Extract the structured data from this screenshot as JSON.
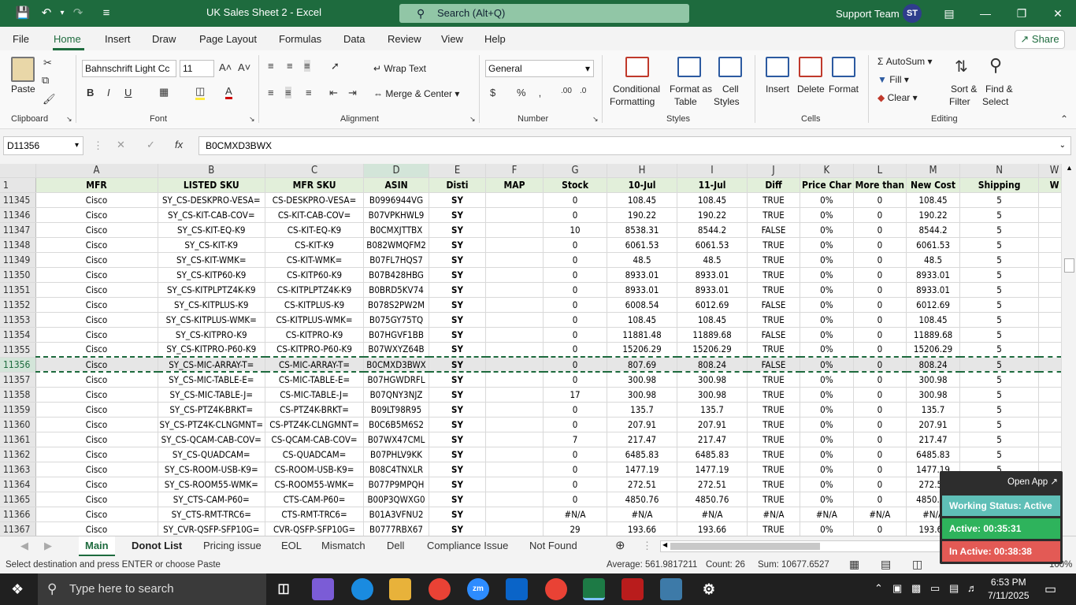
{
  "app": {
    "doc_title": "UK Sales Sheet 2  -  Excel",
    "search_placeholder": "Search (Alt+Q)",
    "account_name": "Support Team",
    "account_initials": "ST"
  },
  "ribbon_tabs": [
    "File",
    "Home",
    "Insert",
    "Draw",
    "Page Layout",
    "Formulas",
    "Data",
    "Review",
    "View",
    "Help"
  ],
  "share_label": "Share",
  "ribbon": {
    "clipboard": {
      "paste": "Paste",
      "group": "Clipboard"
    },
    "font": {
      "name": "Bahnschrift Light Cc",
      "size": "11",
      "group": "Font",
      "bold": "B",
      "italic": "I",
      "underline": "U"
    },
    "alignment": {
      "wrap": "Wrap Text",
      "merge": "Merge & Center",
      "group": "Alignment"
    },
    "number": {
      "format": "General",
      "group": "Number"
    },
    "styles": {
      "conditional": "Conditional",
      "conditional2": "Formatting",
      "format_table": "Format as",
      "format_table2": "Table",
      "cell_styles": "Cell",
      "cell_styles2": "Styles",
      "group": "Styles"
    },
    "cells": {
      "insert": "Insert",
      "delete": "Delete",
      "format": "Format",
      "group": "Cells"
    },
    "editing": {
      "autosum": "AutoSum",
      "fill": "Fill",
      "clear": "Clear",
      "sort": "Sort &",
      "sort2": "Filter",
      "find": "Find &",
      "find2": "Select",
      "group": "Editing"
    }
  },
  "formula_bar": {
    "name_box": "D11356",
    "fx": "fx",
    "content": "B0CMXD3BWX"
  },
  "grid": {
    "columns": [
      "A",
      "B",
      "C",
      "D",
      "E",
      "F",
      "G",
      "H",
      "I",
      "J",
      "K",
      "L",
      "M",
      "N",
      "W"
    ],
    "header_row_num": "1",
    "headers": [
      "MFR",
      "LISTED SKU",
      "MFR SKU",
      "ASIN",
      "Disti",
      "MAP",
      "Stock",
      "10-Jul",
      "11-Jul",
      "Diff",
      "Price Char",
      "More than",
      "New Cost",
      "Shipping",
      "W"
    ],
    "rows": [
      {
        "n": "11345",
        "c": [
          "Cisco",
          "SY_CS-DESKPRO-VESA=",
          "CS-DESKPRO-VESA=",
          "B0996944VG",
          "SY",
          "",
          "0",
          "108.45",
          "108.45",
          "TRUE",
          "0%",
          "0",
          "108.45",
          "5",
          ""
        ]
      },
      {
        "n": "11346",
        "c": [
          "Cisco",
          "SY_CS-KIT-CAB-COV=",
          "CS-KIT-CAB-COV=",
          "B07VPKHWL9",
          "SY",
          "",
          "0",
          "190.22",
          "190.22",
          "TRUE",
          "0%",
          "0",
          "190.22",
          "5",
          ""
        ]
      },
      {
        "n": "11347",
        "c": [
          "Cisco",
          "SY_CS-KIT-EQ-K9",
          "CS-KIT-EQ-K9",
          "B0CMXJTTBX",
          "SY",
          "",
          "10",
          "8538.31",
          "8544.2",
          "FALSE",
          "0%",
          "0",
          "8544.2",
          "5",
          ""
        ]
      },
      {
        "n": "11348",
        "c": [
          "Cisco",
          "SY_CS-KIT-K9",
          "CS-KIT-K9",
          "B082WMQFM2",
          "SY",
          "",
          "0",
          "6061.53",
          "6061.53",
          "TRUE",
          "0%",
          "0",
          "6061.53",
          "5",
          ""
        ]
      },
      {
        "n": "11349",
        "c": [
          "Cisco",
          "SY_CS-KIT-WMK=",
          "CS-KIT-WMK=",
          "B07FL7HQS7",
          "SY",
          "",
          "0",
          "48.5",
          "48.5",
          "TRUE",
          "0%",
          "0",
          "48.5",
          "5",
          ""
        ]
      },
      {
        "n": "11350",
        "c": [
          "Cisco",
          "SY_CS-KITP60-K9",
          "CS-KITP60-K9",
          "B07B428HBG",
          "SY",
          "",
          "0",
          "8933.01",
          "8933.01",
          "TRUE",
          "0%",
          "0",
          "8933.01",
          "5",
          ""
        ]
      },
      {
        "n": "11351",
        "c": [
          "Cisco",
          "SY_CS-KITPLPTZ4K-K9",
          "CS-KITPLPTZ4K-K9",
          "B0BRD5KV74",
          "SY",
          "",
          "0",
          "8933.01",
          "8933.01",
          "TRUE",
          "0%",
          "0",
          "8933.01",
          "5",
          ""
        ]
      },
      {
        "n": "11352",
        "c": [
          "Cisco",
          "SY_CS-KITPLUS-K9",
          "CS-KITPLUS-K9",
          "B078S2PW2M",
          "SY",
          "",
          "0",
          "6008.54",
          "6012.69",
          "FALSE",
          "0%",
          "0",
          "6012.69",
          "5",
          ""
        ]
      },
      {
        "n": "11353",
        "c": [
          "Cisco",
          "SY_CS-KITPLUS-WMK=",
          "CS-KITPLUS-WMK=",
          "B075GY75TQ",
          "SY",
          "",
          "0",
          "108.45",
          "108.45",
          "TRUE",
          "0%",
          "0",
          "108.45",
          "5",
          ""
        ]
      },
      {
        "n": "11354",
        "c": [
          "Cisco",
          "SY_CS-KITPRO-K9",
          "CS-KITPRO-K9",
          "B07HGVF1BB",
          "SY",
          "",
          "0",
          "11881.48",
          "11889.68",
          "FALSE",
          "0%",
          "0",
          "11889.68",
          "5",
          ""
        ]
      },
      {
        "n": "11355",
        "c": [
          "Cisco",
          "SY_CS-KITPRO-P60-K9",
          "CS-KITPRO-P60-K9",
          "B07WXYZ64B",
          "SY",
          "",
          "0",
          "15206.29",
          "15206.29",
          "TRUE",
          "0%",
          "0",
          "15206.29",
          "5",
          ""
        ]
      },
      {
        "n": "11356",
        "c": [
          "Cisco",
          "SY_CS-MIC-ARRAY-T=",
          "CS-MIC-ARRAY-T=",
          "B0CMXD3BWX",
          "SY",
          "",
          "0",
          "807.69",
          "808.24",
          "FALSE",
          "0%",
          "0",
          "808.24",
          "5",
          ""
        ]
      },
      {
        "n": "11357",
        "c": [
          "Cisco",
          "SY_CS-MIC-TABLE-E=",
          "CS-MIC-TABLE-E=",
          "B07HGWDRFL",
          "SY",
          "",
          "0",
          "300.98",
          "300.98",
          "TRUE",
          "0%",
          "0",
          "300.98",
          "5",
          ""
        ]
      },
      {
        "n": "11358",
        "c": [
          "Cisco",
          "SY_CS-MIC-TABLE-J=",
          "CS-MIC-TABLE-J=",
          "B07QNY3NJZ",
          "SY",
          "",
          "17",
          "300.98",
          "300.98",
          "TRUE",
          "0%",
          "0",
          "300.98",
          "5",
          ""
        ]
      },
      {
        "n": "11359",
        "c": [
          "Cisco",
          "SY_CS-PTZ4K-BRKT=",
          "CS-PTZ4K-BRKT=",
          "B09LT98R95",
          "SY",
          "",
          "0",
          "135.7",
          "135.7",
          "TRUE",
          "0%",
          "0",
          "135.7",
          "5",
          ""
        ]
      },
      {
        "n": "11360",
        "c": [
          "Cisco",
          "SY_CS-PTZ4K-CLNGMNT=",
          "CS-PTZ4K-CLNGMNT=",
          "B0C6B5M6S2",
          "SY",
          "",
          "0",
          "207.91",
          "207.91",
          "TRUE",
          "0%",
          "0",
          "207.91",
          "5",
          ""
        ]
      },
      {
        "n": "11361",
        "c": [
          "Cisco",
          "SY_CS-QCAM-CAB-COV=",
          "CS-QCAM-CAB-COV=",
          "B07WX47CML",
          "SY",
          "",
          "7",
          "217.47",
          "217.47",
          "TRUE",
          "0%",
          "0",
          "217.47",
          "5",
          ""
        ]
      },
      {
        "n": "11362",
        "c": [
          "Cisco",
          "SY_CS-QUADCAM=",
          "CS-QUADCAM=",
          "B07PHLV9KK",
          "SY",
          "",
          "0",
          "6485.83",
          "6485.83",
          "TRUE",
          "0%",
          "0",
          "6485.83",
          "5",
          ""
        ]
      },
      {
        "n": "11363",
        "c": [
          "Cisco",
          "SY_CS-ROOM-USB-K9=",
          "CS-ROOM-USB-K9=",
          "B08C4TNXLR",
          "SY",
          "",
          "0",
          "1477.19",
          "1477.19",
          "TRUE",
          "0%",
          "0",
          "1477.19",
          "5",
          ""
        ]
      },
      {
        "n": "11364",
        "c": [
          "Cisco",
          "SY_CS-ROOM55-WMK=",
          "CS-ROOM55-WMK=",
          "B077P9MPQH",
          "SY",
          "",
          "0",
          "272.51",
          "272.51",
          "TRUE",
          "0%",
          "0",
          "272.51",
          "5",
          ""
        ]
      },
      {
        "n": "11365",
        "c": [
          "Cisco",
          "SY_CTS-CAM-P60=",
          "CTS-CAM-P60=",
          "B00P3QWXG0",
          "SY",
          "",
          "0",
          "4850.76",
          "4850.76",
          "TRUE",
          "0%",
          "0",
          "4850.76",
          "5",
          ""
        ]
      },
      {
        "n": "11366",
        "c": [
          "Cisco",
          "SY_CTS-RMT-TRC6=",
          "CTS-RMT-TRC6=",
          "B01A3VFNU2",
          "SY",
          "",
          "#N/A",
          "#N/A",
          "#N/A",
          "#N/A",
          "#N/A",
          "#N/A",
          "#N/A",
          "5",
          ""
        ]
      },
      {
        "n": "11367",
        "c": [
          "Cisco",
          "SY_CVR-QSFP-SFP10G=",
          "CVR-QSFP-SFP10G=",
          "B0777RBX67",
          "SY",
          "",
          "29",
          "193.66",
          "193.66",
          "TRUE",
          "0%",
          "0",
          "193.66",
          "5",
          ""
        ]
      }
    ]
  },
  "sheet_tabs": [
    "Main",
    "Donot List",
    "Pricing issue",
    "EOL",
    "Mismatch",
    "Dell",
    "Compliance Issue",
    "Not Found"
  ],
  "status_bar": {
    "message": "Select destination and press ENTER or choose Paste",
    "average": "Average: 561.9817211",
    "count": "Count: 26",
    "sum": "Sum: 10677.6527",
    "zoom": "100%"
  },
  "widget": {
    "open_app": "Open App ↗",
    "working_status": "Working Status: Active",
    "active": "Active: 00:35:31",
    "inactive": "In Active: 00:38:38",
    "colors": {
      "status": "#5fbfb7",
      "active": "#2eb35c",
      "inactive": "#e35a55"
    }
  },
  "taskbar": {
    "search_placeholder": "Type here to search",
    "time": "6:53 PM",
    "date": "7/11/2025"
  },
  "colors": {
    "excel_green": "#1e6b3e",
    "header_fill": "#e2efda"
  }
}
